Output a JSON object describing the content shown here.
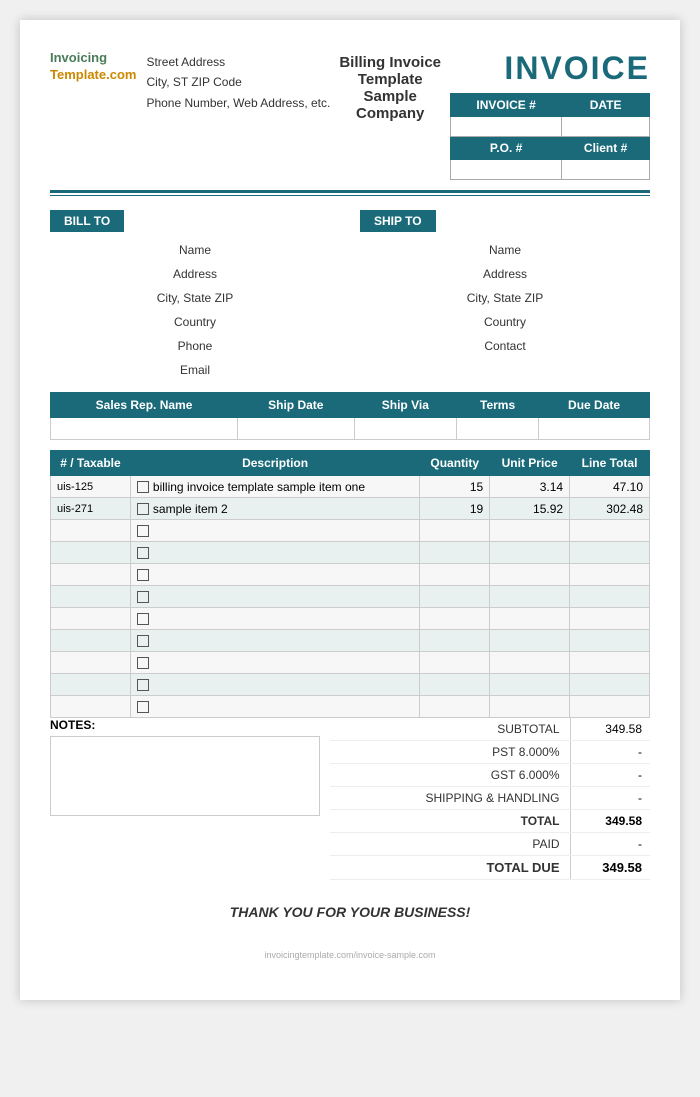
{
  "header": {
    "logo_line1": "Invoicing",
    "logo_line2": "Template.com",
    "company_name": "Billing Invoice Template Sample Company",
    "invoice_title": "INVOICE",
    "address_line1": "Street Address",
    "address_line2": "City, ST  ZIP Code",
    "address_line3": "Phone Number, Web Address, etc.",
    "invoice_table": {
      "col1_header": "INVOICE #",
      "col2_header": "DATE",
      "col3_header": "P.O. #",
      "col4_header": "Client #"
    }
  },
  "bill_to": {
    "label": "BILL TO",
    "name": "Name",
    "address": "Address",
    "city_state_zip": "City, State ZIP",
    "country": "Country",
    "phone": "Phone",
    "email": "Email"
  },
  "ship_to": {
    "label": "SHIP TO",
    "name": "Name",
    "address": "Address",
    "city_state_zip": "City, State ZIP",
    "country": "Country",
    "contact": "Contact"
  },
  "sales_table": {
    "headers": [
      "Sales Rep. Name",
      "Ship Date",
      "Ship Via",
      "Terms",
      "Due Date"
    ]
  },
  "items_table": {
    "headers": [
      "# / Taxable",
      "Description",
      "Quantity",
      "Unit Price",
      "Line Total"
    ],
    "rows": [
      {
        "id": "uis-125",
        "checked": false,
        "description": "billing invoice template sample item one",
        "quantity": "15",
        "unit_price": "3.14",
        "line_total": "47.10"
      },
      {
        "id": "uis-271",
        "checked": false,
        "description": "sample item 2",
        "quantity": "19",
        "unit_price": "15.92",
        "line_total": "302.48"
      },
      {
        "id": "",
        "checked": false,
        "description": "",
        "quantity": "",
        "unit_price": "",
        "line_total": ""
      },
      {
        "id": "",
        "checked": false,
        "description": "",
        "quantity": "",
        "unit_price": "",
        "line_total": ""
      },
      {
        "id": "",
        "checked": false,
        "description": "",
        "quantity": "",
        "unit_price": "",
        "line_total": ""
      },
      {
        "id": "",
        "checked": false,
        "description": "",
        "quantity": "",
        "unit_price": "",
        "line_total": ""
      },
      {
        "id": "",
        "checked": false,
        "description": "",
        "quantity": "",
        "unit_price": "",
        "line_total": ""
      },
      {
        "id": "",
        "checked": false,
        "description": "",
        "quantity": "",
        "unit_price": "",
        "line_total": ""
      },
      {
        "id": "",
        "checked": false,
        "description": "",
        "quantity": "",
        "unit_price": "",
        "line_total": ""
      },
      {
        "id": "",
        "checked": false,
        "description": "",
        "quantity": "",
        "unit_price": "",
        "line_total": ""
      },
      {
        "id": "",
        "checked": false,
        "description": "",
        "quantity": "",
        "unit_price": "",
        "line_total": ""
      }
    ]
  },
  "totals": {
    "subtotal_label": "SUBTOTAL",
    "subtotal_value": "349.58",
    "pst_label": "PST",
    "pst_rate": "8.000%",
    "pst_value": "-",
    "gst_label": "GST",
    "gst_rate": "6.000%",
    "gst_value": "-",
    "shipping_label": "SHIPPING & HANDLING",
    "shipping_value": "-",
    "total_label": "TOTAL",
    "total_value": "349.58",
    "paid_label": "PAID",
    "paid_value": "-",
    "total_due_label": "TOTAL DUE",
    "total_due_value": "349.58"
  },
  "notes": {
    "label": "NOTES:"
  },
  "footer": {
    "thank_you": "THANK YOU FOR YOUR BUSINESS!",
    "watermark": "invoicingtemplate.com/invoice-sample.com"
  }
}
